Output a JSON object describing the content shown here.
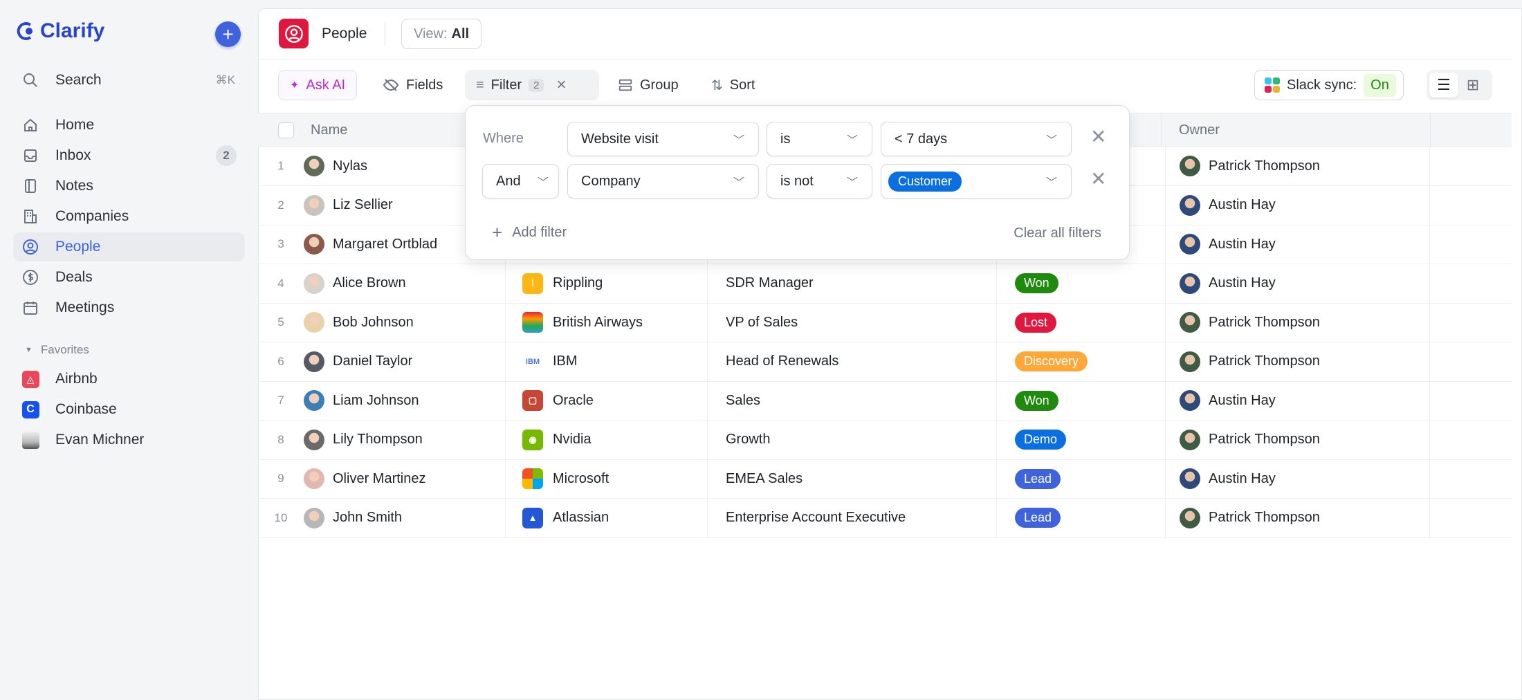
{
  "app": {
    "name": "Clarify"
  },
  "sidebar": {
    "search": {
      "label": "Search",
      "shortcut": "⌘K"
    },
    "items": [
      {
        "label": "Home",
        "icon": "home-icon"
      },
      {
        "label": "Inbox",
        "icon": "inbox-icon",
        "count": "2"
      },
      {
        "label": "Notes",
        "icon": "notes-icon"
      },
      {
        "label": "Companies",
        "icon": "building-icon"
      },
      {
        "label": "People",
        "icon": "person-circle-icon",
        "active": true
      },
      {
        "label": "Deals",
        "icon": "dollar-icon"
      },
      {
        "label": "Meetings",
        "icon": "calendar-icon"
      }
    ],
    "favorites_label": "Favorites",
    "favorites": [
      {
        "label": "Airbnb"
      },
      {
        "label": "Coinbase"
      },
      {
        "label": "Evan Michner"
      }
    ]
  },
  "header": {
    "title": "People",
    "view_label": "View:",
    "view_value": "All"
  },
  "toolbar": {
    "ask_ai": "Ask AI",
    "fields": "Fields",
    "filter": "Filter",
    "filter_count": "2",
    "group": "Group",
    "sort": "Sort",
    "slack_label": "Slack sync:",
    "slack_state": "On"
  },
  "table": {
    "columns": {
      "name": "Name",
      "owner": "Owner"
    },
    "rows": [
      {
        "n": "1",
        "name": "Nylas",
        "company": "",
        "title": "",
        "stage": "",
        "owner": "Patrick Thompson"
      },
      {
        "n": "2",
        "name": "Liz Sellier",
        "company": "",
        "title": "",
        "stage": "",
        "owner": "Austin Hay"
      },
      {
        "n": "3",
        "name": "Margaret Ortblad",
        "company": "",
        "title": "",
        "stage": "",
        "owner": "Austin Hay"
      },
      {
        "n": "4",
        "name": "Alice Brown",
        "company": "Rippling",
        "title": "SDR Manager",
        "stage": "Won",
        "owner": "Austin Hay"
      },
      {
        "n": "5",
        "name": "Bob Johnson",
        "company": "British Airways",
        "title": "VP of Sales",
        "stage": "Lost",
        "owner": "Patrick Thompson"
      },
      {
        "n": "6",
        "name": "Daniel Taylor",
        "company": "IBM",
        "title": "Head of Renewals",
        "stage": "Discovery",
        "owner": "Patrick Thompson"
      },
      {
        "n": "7",
        "name": "Liam Johnson",
        "company": "Oracle",
        "title": "Sales",
        "stage": "Won",
        "owner": "Austin Hay"
      },
      {
        "n": "8",
        "name": "Lily Thompson",
        "company": "Nvidia",
        "title": "Growth",
        "stage": "Demo",
        "owner": "Patrick Thompson"
      },
      {
        "n": "9",
        "name": "Oliver Martinez",
        "company": "Microsoft",
        "title": "EMEA Sales",
        "stage": "Lead",
        "owner": "Austin Hay"
      },
      {
        "n": "10",
        "name": "John Smith",
        "company": "Atlassian",
        "title": "Enterprise Account Executive",
        "stage": "Lead",
        "owner": "Patrick Thompson"
      }
    ]
  },
  "stage_colors": {
    "Won": "#1f8a0e",
    "Lost": "#e0173f",
    "Discovery": "#ffa83a",
    "Demo": "#0a6fe0",
    "Lead": "#3e63dd"
  },
  "filter_popup": {
    "where": "Where",
    "row1": {
      "field": "Website visit",
      "op": "is",
      "value": "< 7 days"
    },
    "row2": {
      "conj": "And",
      "field": "Company",
      "op": "is not",
      "value": "Customer"
    },
    "add": "Add filter",
    "clear": "Clear all filters"
  }
}
